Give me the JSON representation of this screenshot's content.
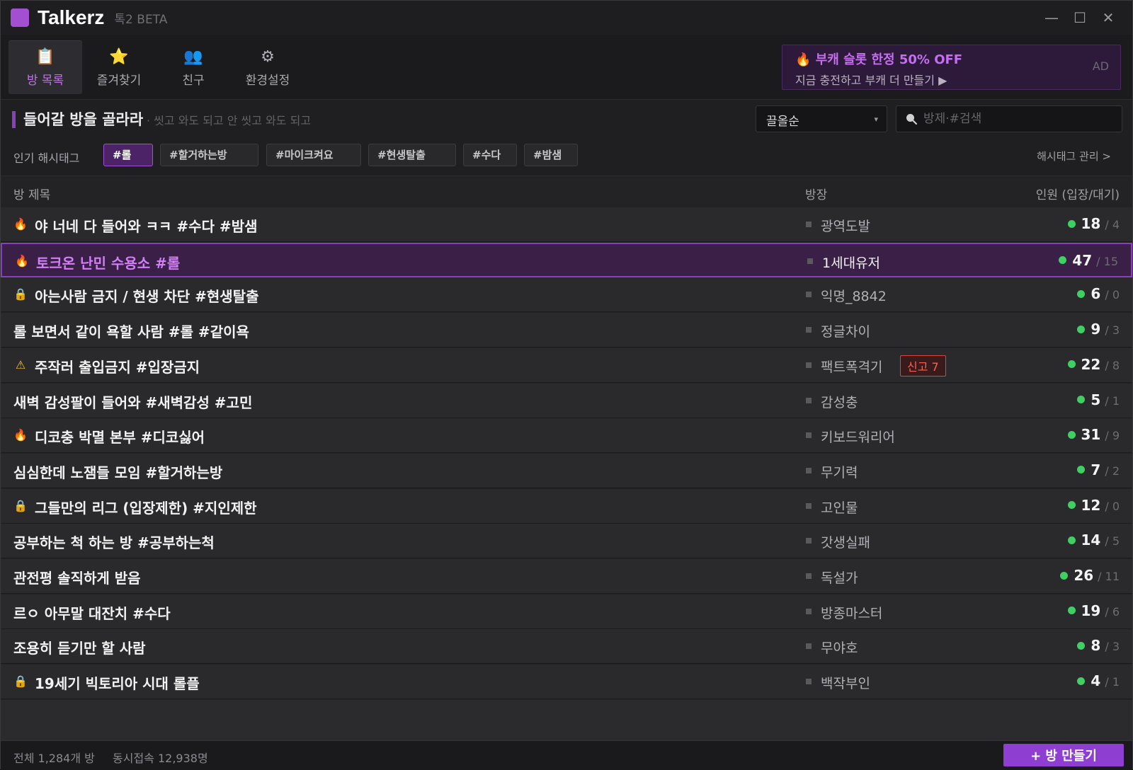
{
  "window": {
    "app_name": "Talkerz",
    "app_subtitle": "톡2 BETA",
    "controls": {
      "minimize": "—",
      "maximize": "☐",
      "close": "✕"
    }
  },
  "nav": {
    "tabs": [
      {
        "label": "방 목록",
        "icon": "room-list-icon",
        "glyph": "📋",
        "active": true
      },
      {
        "label": "즐겨찾기",
        "icon": "star-icon",
        "glyph": "⭐",
        "active": false
      },
      {
        "label": "친구",
        "icon": "friends-icon",
        "glyph": "👥",
        "active": false
      },
      {
        "label": "환경설정",
        "icon": "gear-icon",
        "glyph": "⚙",
        "active": false
      }
    ]
  },
  "ad": {
    "icon": "🔥",
    "title": "부캐 슬롯 한정 50% OFF",
    "text": "지금 충전하고 부캐 더 만들기 ▶",
    "tag": "AD"
  },
  "header": {
    "title": "들어갈 방을 골라라",
    "subtitle": "· 씻고 와도 되고 안 씻고 와도 되고"
  },
  "sort": {
    "selected": "끌올순",
    "caret": "▾"
  },
  "search": {
    "placeholder": "방제·#검색",
    "value": ""
  },
  "hashtags": {
    "label": "인기 해시태그",
    "items": [
      "#롤",
      "#할거하는방",
      "#마이크켜요",
      "#현생탈출",
      "#수다",
      "#밤샘"
    ],
    "active_index": 0,
    "manage_label": "해시태그 관리 >"
  },
  "table": {
    "columns": {
      "title": "방 제목",
      "host": "방장",
      "count": "인원 (입장/대기)"
    },
    "rows": [
      {
        "icon": "fire-icon",
        "glyph": "🔥",
        "title": "야 너네 다 들어와 ㅋㅋ #수다 #밤샘",
        "host": "광역도발",
        "in": "18",
        "wait": "/ 4",
        "report": ""
      },
      {
        "icon": "fire-icon",
        "glyph": "🔥",
        "title": "토크온 난민 수용소 #롤",
        "host": "1세대유저",
        "in": "47",
        "wait": "/ 15",
        "report": "",
        "highlight": true
      },
      {
        "icon": "lock-icon",
        "glyph": "🔒",
        "title": "아는사람 금지 / 현생 차단 #현생탈출",
        "host": "익명_8842",
        "in": "6",
        "wait": "/ 0",
        "report": ""
      },
      {
        "icon": "",
        "glyph": "",
        "title": "롤 보면서 같이 욕할 사람 #롤 #같이욕",
        "host": "정글차이",
        "in": "9",
        "wait": "/ 3",
        "report": ""
      },
      {
        "icon": "warning-icon",
        "glyph": "⚠",
        "title": "주작러 출입금지 #입장금지",
        "host": "팩트폭격기",
        "in": "22",
        "wait": "/ 8",
        "report": "신고 7"
      },
      {
        "icon": "",
        "glyph": "",
        "title": "새벽 감성팔이 들어와 #새벽감성 #고민",
        "host": "감성충",
        "in": "5",
        "wait": "/ 1",
        "report": ""
      },
      {
        "icon": "fire-icon",
        "glyph": "🔥",
        "title": "디코충 박멸 본부 #디코싫어",
        "host": "키보드워리어",
        "in": "31",
        "wait": "/ 9",
        "report": ""
      },
      {
        "icon": "",
        "glyph": "",
        "title": "심심한데 노잼들 모임 #할거하는방",
        "host": "무기력",
        "in": "7",
        "wait": "/ 2",
        "report": ""
      },
      {
        "icon": "lock-icon",
        "glyph": "🔒",
        "title": "그들만의 리그 (입장제한) #지인제한",
        "host": "고인물",
        "in": "12",
        "wait": "/ 0",
        "report": ""
      },
      {
        "icon": "",
        "glyph": "",
        "title": "공부하는 척 하는 방 #공부하는척",
        "host": "갓생실패",
        "in": "14",
        "wait": "/ 5",
        "report": ""
      },
      {
        "icon": "",
        "glyph": "",
        "title": "관전평 솔직하게 받음",
        "host": "독설가",
        "in": "26",
        "wait": "/ 11",
        "report": ""
      },
      {
        "icon": "",
        "glyph": "",
        "title": "르ㅇ 아무말 대잔치 #수다",
        "host": "방종마스터",
        "in": "19",
        "wait": "/ 6",
        "report": ""
      },
      {
        "icon": "",
        "glyph": "",
        "title": "조용히 듣기만 할 사람",
        "host": "무야호",
        "in": "8",
        "wait": "/ 3",
        "report": ""
      },
      {
        "icon": "lock-icon",
        "glyph": "🔒",
        "title": "19세기 빅토리아 시대 롤플",
        "host": "백작부인",
        "in": "4",
        "wait": "/ 1",
        "report": ""
      }
    ]
  },
  "footer": {
    "total": "전체 1,284개 방",
    "online": "동시접속 12,938명",
    "create_button": "+ 방 만들기"
  },
  "colors": {
    "accent": "#8e3fd1",
    "accent_text": "#c56ef0",
    "online_dot": "#3fcf62",
    "report": "#ff6055",
    "warning": "#f2c230",
    "fire": "#ff6a1a"
  }
}
